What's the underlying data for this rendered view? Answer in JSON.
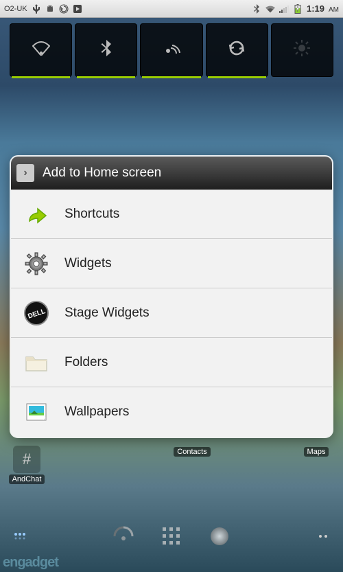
{
  "status": {
    "carrier": "O2-UK",
    "time": "1:19",
    "ampm": "AM"
  },
  "toggles": [
    {
      "name": "wifi",
      "on": true
    },
    {
      "name": "bluetooth",
      "on": true
    },
    {
      "name": "sync",
      "on": true
    },
    {
      "name": "autosync",
      "on": true
    },
    {
      "name": "brightness",
      "on": false
    }
  ],
  "dialog": {
    "title": "Add to Home screen",
    "items": [
      {
        "label": "Shortcuts",
        "icon": "shortcut"
      },
      {
        "label": "Widgets",
        "icon": "gear"
      },
      {
        "label": "Stage Widgets",
        "icon": "dell"
      },
      {
        "label": "Folders",
        "icon": "folder"
      },
      {
        "label": "Wallpapers",
        "icon": "picture"
      }
    ]
  },
  "dock": {
    "apps": [
      {
        "label": "AndChat"
      },
      {
        "label": "Contacts"
      },
      {
        "label": "Maps"
      }
    ]
  },
  "watermark": "engadget",
  "colors": {
    "accent": "#99cc00"
  }
}
